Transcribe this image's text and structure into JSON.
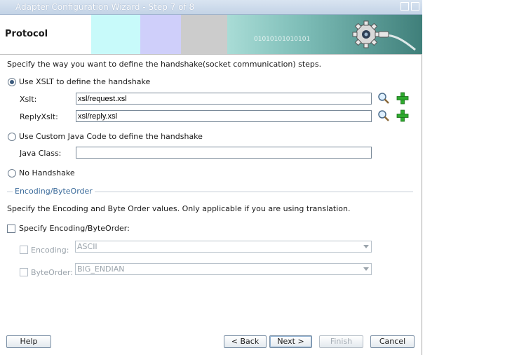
{
  "window": {
    "title": "Adapter Configuration Wizard - Step 7 of 8"
  },
  "banner": {
    "heading": "Protocol",
    "binary_text": "01010101010101"
  },
  "intro": "Specify the way you want to define the handshake(socket communication) steps.",
  "handshake": {
    "xslt_option": "Use XSLT to define the handshake",
    "xslt_label": "Xslt:",
    "xslt_value": "xsl/request.xsl",
    "reply_label": "ReplyXslt:",
    "reply_value": "xsl/reply.xsl",
    "java_option": "Use Custom Java Code to define the handshake",
    "java_label": "Java Class:",
    "java_value": "",
    "none_option": "No Handshake",
    "selected": "xslt"
  },
  "encoding_group": {
    "title": "Encoding/ByteOrder",
    "description": "Specify the Encoding and Byte Order values. Only applicable if you are using translation.",
    "specify_label": "Specify Encoding/ByteOrder:",
    "encoding_label": "Encoding:",
    "encoding_value": "ASCII",
    "byteorder_label": "ByteOrder:",
    "byteorder_value": "BIG_ENDIAN"
  },
  "buttons": {
    "help": "Help",
    "back": "< Back",
    "next": "Next >",
    "finish": "Finish",
    "cancel": "Cancel"
  },
  "colors": {
    "accent": "#3c5b7d",
    "group_title": "#3a6a9a",
    "add_icon": "#2eaa2e"
  },
  "icons": [
    "search-icon",
    "add-icon",
    "gear-icon"
  ]
}
